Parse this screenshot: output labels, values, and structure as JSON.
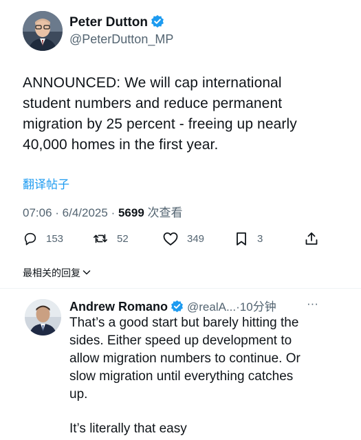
{
  "tweet": {
    "author_name": "Peter Dutton",
    "author_handle": "@PeterDutton_MP",
    "text_lines": [
      "ANNOUNCED: We will cap international",
      "student numbers and reduce permanent",
      "migration by 25 percent - freeing up nearly",
      "40,000 homes in the first year."
    ],
    "translate_label": "翻译帖子",
    "time": "07:06",
    "date": "6/4/2025",
    "views_count": "5699",
    "views_label": "次查看",
    "replies": "153",
    "retweets": "52",
    "likes": "349",
    "bookmarks": "3"
  },
  "sort_label": "最相关的回复",
  "reply": {
    "author_name": "Andrew Romano",
    "author_handle": "@realA...",
    "time_ago": "·10分钟",
    "more": "···",
    "text_lines": [
      "That’s a good start but barely hitting the",
      "sides. Either speed up development to",
      "allow migration numbers to continue. Or",
      "slow migration until everything catches",
      "up."
    ],
    "text_line2": "It’s literally that easy"
  },
  "colors": {
    "accent": "#1d9bf0",
    "secondary_text": "#536471",
    "primary_text": "#0f1419"
  },
  "icons": [
    "verified-badge-icon",
    "reply-icon",
    "retweet-icon",
    "like-icon",
    "bookmark-icon",
    "share-icon",
    "chevron-down-icon",
    "more-icon"
  ]
}
